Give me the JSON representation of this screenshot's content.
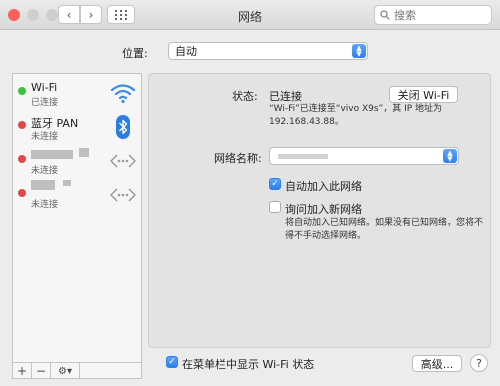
{
  "window": {
    "title": "网络"
  },
  "toolbar": {
    "search_placeholder": "搜索"
  },
  "location": {
    "label": "位置:",
    "value": "自动"
  },
  "services": [
    {
      "name": "Wi-Fi",
      "status": "已连接",
      "status_color": "#3fbf3f",
      "icon": "wifi-icon"
    },
    {
      "name": "蓝牙 PAN",
      "status": "未连接",
      "status_color": "#e04848",
      "icon": "bluetooth-icon"
    },
    {
      "name": "",
      "status": "未连接",
      "status_color": "#e04848",
      "icon": "ethernet-dots-icon"
    },
    {
      "name": "",
      "status": "未连接",
      "status_color": "#e04848",
      "icon": "ethernet-dots-icon"
    }
  ],
  "sidebar_footer": {
    "add": "+",
    "remove": "−",
    "gear": "⚙▾"
  },
  "detail": {
    "status_label": "状态:",
    "status_value": "已连接",
    "turn_off_button": "关闭 Wi-Fi",
    "status_desc_line1": "“Wi-Fi”已连接至“vivo X9s”，其 IP 地址为",
    "status_desc_line2": "192.168.43.88。",
    "network_name_label": "网络名称:",
    "auto_join_label": "自动加入此网络",
    "auto_join_checked": true,
    "ask_join_label": "询问加入新网络",
    "ask_join_checked": false,
    "ask_join_desc_line1": "将自动加入已知网络。如果没有已知网络，您将不",
    "ask_join_desc_line2": "得不手动选择网络。"
  },
  "bottom": {
    "show_menu_label": "在菜单栏中显示 Wi-Fi 状态",
    "show_menu_checked": true,
    "advanced_button": "高级...",
    "help": "?"
  },
  "colors": {
    "accent": "#2e7ff0",
    "close": "#fc605b",
    "minimize": "#fdbc40",
    "zoom": "#34c84a"
  }
}
